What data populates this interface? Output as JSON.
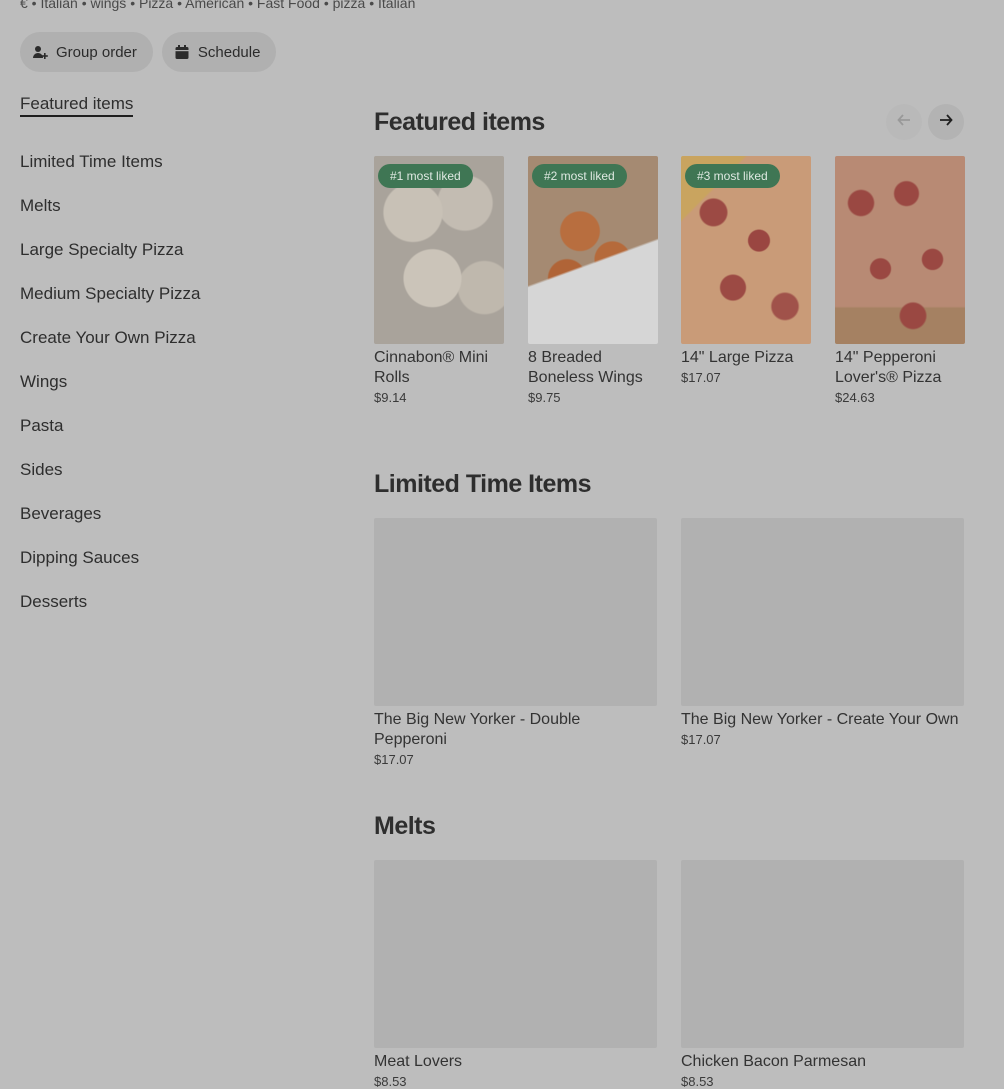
{
  "header": {
    "crumbs": "€ • Italian • wings • Pizza • American • Fast Food • pizza • Italian",
    "group_order_label": "Group order",
    "schedule_label": "Schedule"
  },
  "sidebar": {
    "items": [
      {
        "label": "Featured items",
        "active": true
      },
      {
        "label": "Limited Time Items"
      },
      {
        "label": "Melts"
      },
      {
        "label": "Large Specialty Pizza"
      },
      {
        "label": "Medium Specialty Pizza"
      },
      {
        "label": "Create Your Own Pizza"
      },
      {
        "label": "Wings"
      },
      {
        "label": "Pasta"
      },
      {
        "label": "Sides"
      },
      {
        "label": "Beverages"
      },
      {
        "label": "Dipping Sauces"
      },
      {
        "label": "Desserts"
      }
    ]
  },
  "featured": {
    "title": "Featured items",
    "items": [
      {
        "badge": "#1 most liked",
        "name": "Cinnabon® Mini Rolls",
        "price": "$9.14"
      },
      {
        "badge": "#2 most liked",
        "name": "8 Breaded Boneless Wings",
        "price": "$9.75"
      },
      {
        "badge": "#3 most liked",
        "name": "14\" Large Pizza",
        "price": "$17.07"
      },
      {
        "name": "14\" Pepperoni Lover's® Pizza",
        "price": "$24.63"
      }
    ]
  },
  "limited": {
    "title": "Limited Time Items",
    "items": [
      {
        "name": "The Big New Yorker - Double Pepperoni",
        "price": "$17.07"
      },
      {
        "name": "The Big New Yorker - Create Your Own",
        "price": "$17.07"
      }
    ]
  },
  "melts": {
    "title": "Melts",
    "items": [
      {
        "name": "Meat Lovers",
        "price": "$8.53"
      },
      {
        "name": "Chicken Bacon Parmesan",
        "price": "$8.53"
      }
    ]
  },
  "icons": {
    "group_order": "person-add-icon",
    "schedule": "calendar-icon",
    "prev": "arrow-left-icon",
    "next": "arrow-right-icon"
  },
  "colors": {
    "overlay_bg": "#bdbdbd",
    "badge_bg": "#3f7654"
  }
}
